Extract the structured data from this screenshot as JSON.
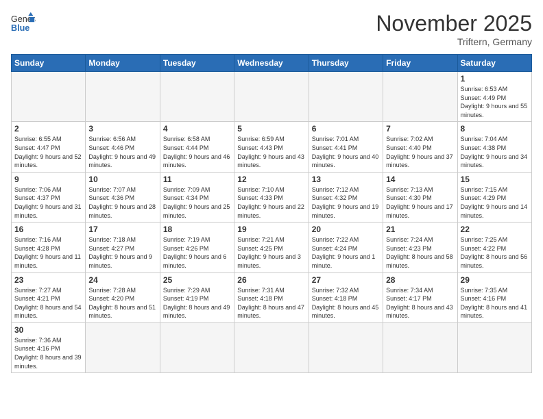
{
  "header": {
    "logo_general": "General",
    "logo_blue": "Blue",
    "month_title": "November 2025",
    "location": "Triftern, Germany"
  },
  "weekdays": [
    "Sunday",
    "Monday",
    "Tuesday",
    "Wednesday",
    "Thursday",
    "Friday",
    "Saturday"
  ],
  "weeks": [
    [
      {
        "day": "",
        "info": ""
      },
      {
        "day": "",
        "info": ""
      },
      {
        "day": "",
        "info": ""
      },
      {
        "day": "",
        "info": ""
      },
      {
        "day": "",
        "info": ""
      },
      {
        "day": "",
        "info": ""
      },
      {
        "day": "1",
        "info": "Sunrise: 6:53 AM\nSunset: 4:49 PM\nDaylight: 9 hours and 55 minutes."
      }
    ],
    [
      {
        "day": "2",
        "info": "Sunrise: 6:55 AM\nSunset: 4:47 PM\nDaylight: 9 hours and 52 minutes."
      },
      {
        "day": "3",
        "info": "Sunrise: 6:56 AM\nSunset: 4:46 PM\nDaylight: 9 hours and 49 minutes."
      },
      {
        "day": "4",
        "info": "Sunrise: 6:58 AM\nSunset: 4:44 PM\nDaylight: 9 hours and 46 minutes."
      },
      {
        "day": "5",
        "info": "Sunrise: 6:59 AM\nSunset: 4:43 PM\nDaylight: 9 hours and 43 minutes."
      },
      {
        "day": "6",
        "info": "Sunrise: 7:01 AM\nSunset: 4:41 PM\nDaylight: 9 hours and 40 minutes."
      },
      {
        "day": "7",
        "info": "Sunrise: 7:02 AM\nSunset: 4:40 PM\nDaylight: 9 hours and 37 minutes."
      },
      {
        "day": "8",
        "info": "Sunrise: 7:04 AM\nSunset: 4:38 PM\nDaylight: 9 hours and 34 minutes."
      }
    ],
    [
      {
        "day": "9",
        "info": "Sunrise: 7:06 AM\nSunset: 4:37 PM\nDaylight: 9 hours and 31 minutes."
      },
      {
        "day": "10",
        "info": "Sunrise: 7:07 AM\nSunset: 4:36 PM\nDaylight: 9 hours and 28 minutes."
      },
      {
        "day": "11",
        "info": "Sunrise: 7:09 AM\nSunset: 4:34 PM\nDaylight: 9 hours and 25 minutes."
      },
      {
        "day": "12",
        "info": "Sunrise: 7:10 AM\nSunset: 4:33 PM\nDaylight: 9 hours and 22 minutes."
      },
      {
        "day": "13",
        "info": "Sunrise: 7:12 AM\nSunset: 4:32 PM\nDaylight: 9 hours and 19 minutes."
      },
      {
        "day": "14",
        "info": "Sunrise: 7:13 AM\nSunset: 4:30 PM\nDaylight: 9 hours and 17 minutes."
      },
      {
        "day": "15",
        "info": "Sunrise: 7:15 AM\nSunset: 4:29 PM\nDaylight: 9 hours and 14 minutes."
      }
    ],
    [
      {
        "day": "16",
        "info": "Sunrise: 7:16 AM\nSunset: 4:28 PM\nDaylight: 9 hours and 11 minutes."
      },
      {
        "day": "17",
        "info": "Sunrise: 7:18 AM\nSunset: 4:27 PM\nDaylight: 9 hours and 9 minutes."
      },
      {
        "day": "18",
        "info": "Sunrise: 7:19 AM\nSunset: 4:26 PM\nDaylight: 9 hours and 6 minutes."
      },
      {
        "day": "19",
        "info": "Sunrise: 7:21 AM\nSunset: 4:25 PM\nDaylight: 9 hours and 3 minutes."
      },
      {
        "day": "20",
        "info": "Sunrise: 7:22 AM\nSunset: 4:24 PM\nDaylight: 9 hours and 1 minute."
      },
      {
        "day": "21",
        "info": "Sunrise: 7:24 AM\nSunset: 4:23 PM\nDaylight: 8 hours and 58 minutes."
      },
      {
        "day": "22",
        "info": "Sunrise: 7:25 AM\nSunset: 4:22 PM\nDaylight: 8 hours and 56 minutes."
      }
    ],
    [
      {
        "day": "23",
        "info": "Sunrise: 7:27 AM\nSunset: 4:21 PM\nDaylight: 8 hours and 54 minutes."
      },
      {
        "day": "24",
        "info": "Sunrise: 7:28 AM\nSunset: 4:20 PM\nDaylight: 8 hours and 51 minutes."
      },
      {
        "day": "25",
        "info": "Sunrise: 7:29 AM\nSunset: 4:19 PM\nDaylight: 8 hours and 49 minutes."
      },
      {
        "day": "26",
        "info": "Sunrise: 7:31 AM\nSunset: 4:18 PM\nDaylight: 8 hours and 47 minutes."
      },
      {
        "day": "27",
        "info": "Sunrise: 7:32 AM\nSunset: 4:18 PM\nDaylight: 8 hours and 45 minutes."
      },
      {
        "day": "28",
        "info": "Sunrise: 7:34 AM\nSunset: 4:17 PM\nDaylight: 8 hours and 43 minutes."
      },
      {
        "day": "29",
        "info": "Sunrise: 7:35 AM\nSunset: 4:16 PM\nDaylight: 8 hours and 41 minutes."
      }
    ],
    [
      {
        "day": "30",
        "info": "Sunrise: 7:36 AM\nSunset: 4:16 PM\nDaylight: 8 hours and 39 minutes."
      },
      {
        "day": "",
        "info": ""
      },
      {
        "day": "",
        "info": ""
      },
      {
        "day": "",
        "info": ""
      },
      {
        "day": "",
        "info": ""
      },
      {
        "day": "",
        "info": ""
      },
      {
        "day": "",
        "info": ""
      }
    ]
  ]
}
